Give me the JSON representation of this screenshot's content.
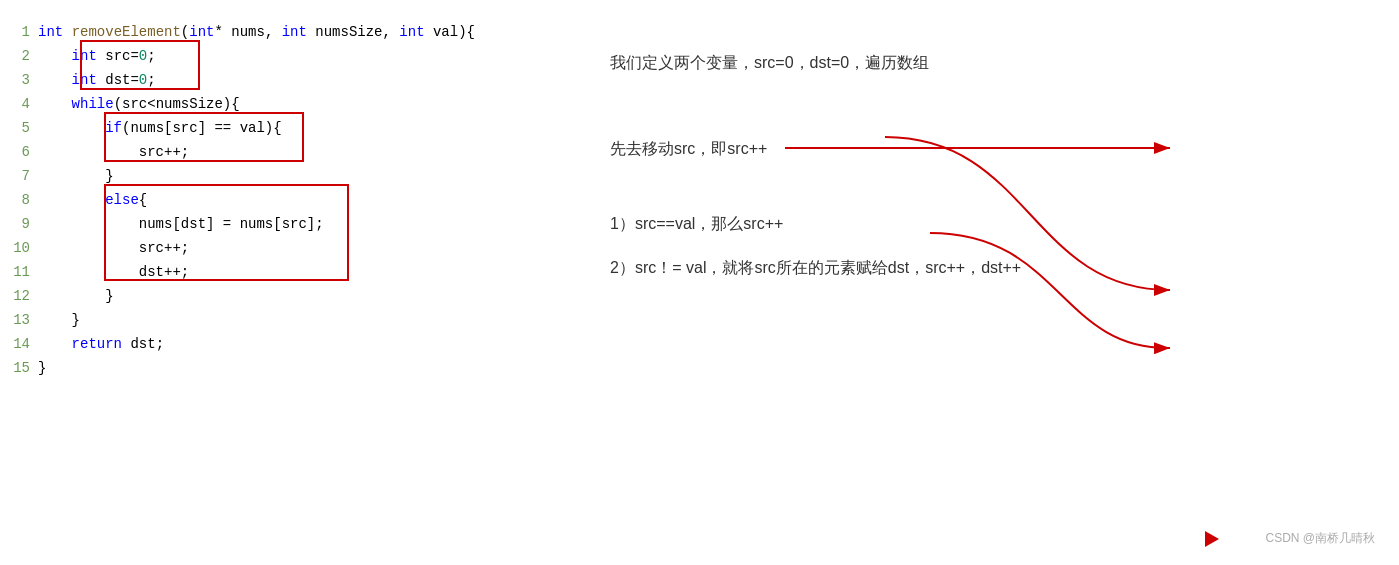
{
  "code": {
    "lines": [
      {
        "num": "1",
        "content": "int removeElement(int* nums, int numsSize, int val){"
      },
      {
        "num": "2",
        "content": "    int src=0;"
      },
      {
        "num": "3",
        "content": "    int dst=0;"
      },
      {
        "num": "4",
        "content": "    while(src<numsSize){"
      },
      {
        "num": "5",
        "content": "        if(nums[src] == val){"
      },
      {
        "num": "6",
        "content": "            src++;"
      },
      {
        "num": "7",
        "content": "        }"
      },
      {
        "num": "8",
        "content": "        else{"
      },
      {
        "num": "9",
        "content": "            nums[dst] = nums[src];"
      },
      {
        "num": "10",
        "content": "            src++;"
      },
      {
        "num": "11",
        "content": "            dst++;"
      },
      {
        "num": "12",
        "content": "        }"
      },
      {
        "num": "13",
        "content": "    }"
      },
      {
        "num": "14",
        "content": "    return dst;"
      },
      {
        "num": "15",
        "content": "}"
      }
    ]
  },
  "annotations": {
    "item1": "我们定义两个变量，src=0，dst=0，遍历数组",
    "item2": "先去移动src，即src++",
    "item3": "1）src==val，那么src++",
    "item4": "2）src！= val，就将src所在的元素赋给dst，src++，dst++"
  },
  "watermark": "CSDN @南桥几晴秋",
  "colors": {
    "keyword": "#0000ff",
    "function": "#795E26",
    "number": "#098658",
    "red": "#cc0000",
    "text": "#333333"
  }
}
